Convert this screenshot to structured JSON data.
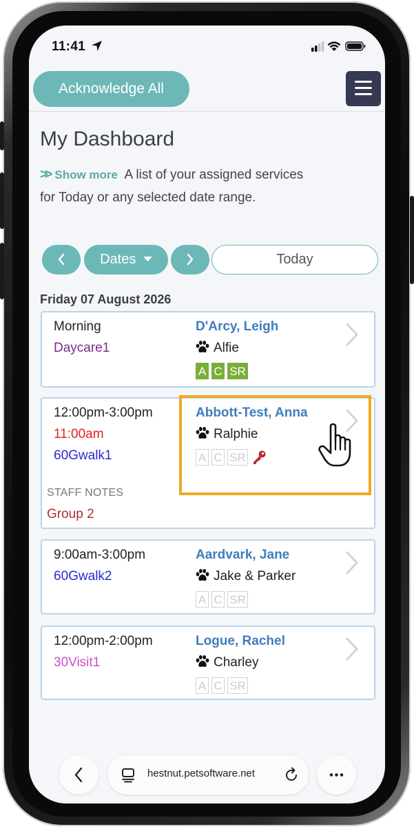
{
  "status_bar": {
    "time": "11:41"
  },
  "header": {
    "acknowledge_label": "Acknowledge All"
  },
  "dashboard": {
    "title": "My Dashboard",
    "show_more": "Show more",
    "description": "A list of your assigned services for Today or any selected date range."
  },
  "date_controls": {
    "dates_label": "Dates",
    "today_label": "Today"
  },
  "date_heading": "Friday 07 August 2026",
  "cards": [
    {
      "time": "Morning",
      "service": "Daycare1",
      "client": "D'Arcy, Leigh",
      "pet": "Alfie",
      "badges": [
        "A",
        "C",
        "SR"
      ],
      "badge_state": "on"
    },
    {
      "time": "12:00pm-3:00pm",
      "arrival": "11:00am",
      "service": "60Gwalk1",
      "client": "Abbott-Test, Anna",
      "pet": "Ralphie",
      "badges": [
        "A",
        "C",
        "SR"
      ],
      "badge_state": "off",
      "staff_notes_label": "STAFF NOTES",
      "staff_notes": "Group 2"
    },
    {
      "time": "9:00am-3:00pm",
      "service": "60Gwalk2",
      "client": "Aardvark, Jane",
      "pet": "Jake & Parker",
      "badges": [
        "A",
        "C",
        "SR"
      ],
      "badge_state": "off"
    },
    {
      "time": "12:00pm-2:00pm",
      "service": "30Visit1",
      "client": "Logue, Rachel",
      "pet": "Charley",
      "badges": [
        "A",
        "C",
        "SR"
      ],
      "badge_state": "off"
    }
  ],
  "browser": {
    "url": "hestnut.petsoftware.net"
  },
  "colors": {
    "accent": "#6cb8b6",
    "client_link": "#3f7dbd",
    "daycare": "#7a2c8c",
    "walk": "#2a2ad0",
    "visit": "#c84fd0",
    "arrival_red": "#e02020",
    "badge_active": "#7aae3a",
    "highlight": "#f0a820"
  },
  "icons": [
    "location-arrow-icon",
    "signal-icon",
    "wifi-icon",
    "battery-icon",
    "menu-icon",
    "double-chevron-icon",
    "chevron-left-icon",
    "chevron-right-icon",
    "caret-down-icon",
    "paw-icon",
    "key-icon",
    "pointer-hand-icon",
    "back-icon",
    "tabs-icon",
    "reload-icon",
    "more-icon"
  ]
}
